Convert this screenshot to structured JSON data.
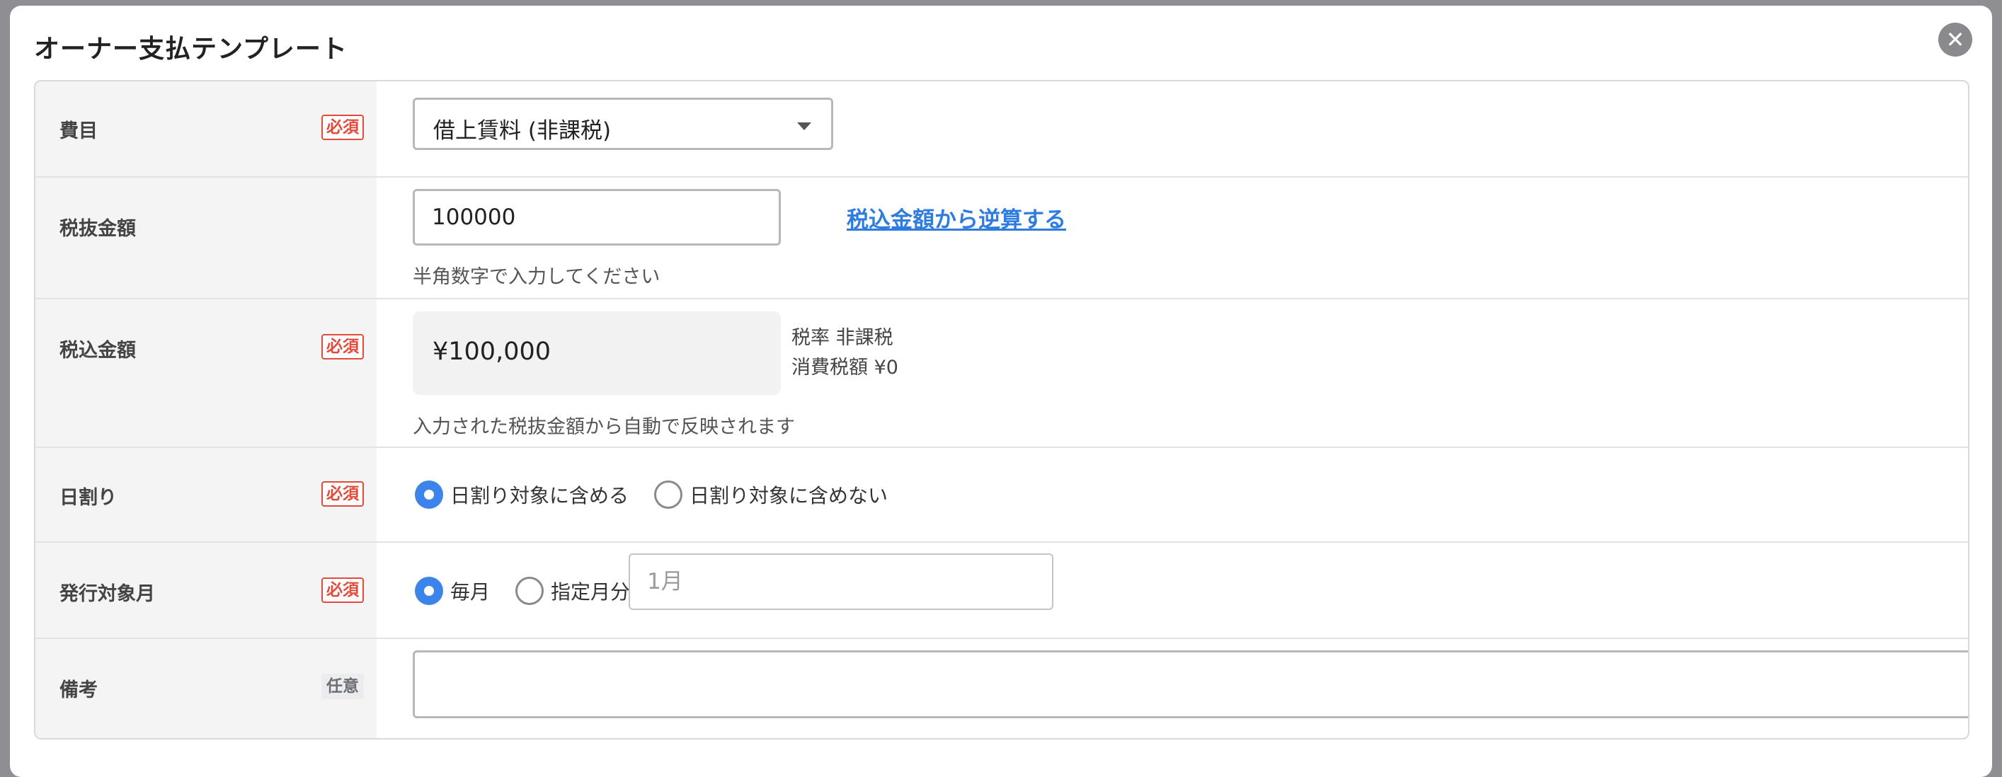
{
  "modal": {
    "title": "オーナー支払テンプレート",
    "close_icon": "close-icon"
  },
  "badges": {
    "required": "必須",
    "optional": "任意"
  },
  "expense_item": {
    "label": "費目",
    "selected": "借上賃料 (非課税)"
  },
  "amount_excl_tax": {
    "label": "税抜金額",
    "value": "100000",
    "reverse_calc_link": "税込金額から逆算する",
    "hint": "半角数字で入力してください"
  },
  "amount_incl_tax": {
    "label": "税込金額",
    "value": "¥100,000",
    "tax_rate": "税率 非課税",
    "consumption_tax": "消費税額 ¥0",
    "hint": "入力された税抜金額から自動で反映されます"
  },
  "proration": {
    "label": "日割り",
    "options": [
      "日割り対象に含める",
      "日割り対象に含めない"
    ],
    "selected_index": 0
  },
  "issue_month": {
    "label": "発行対象月",
    "options": [
      "毎月",
      "指定月分"
    ],
    "selected_index": 0,
    "month_placeholder": "1月"
  },
  "remarks": {
    "label": "備考",
    "value": ""
  }
}
